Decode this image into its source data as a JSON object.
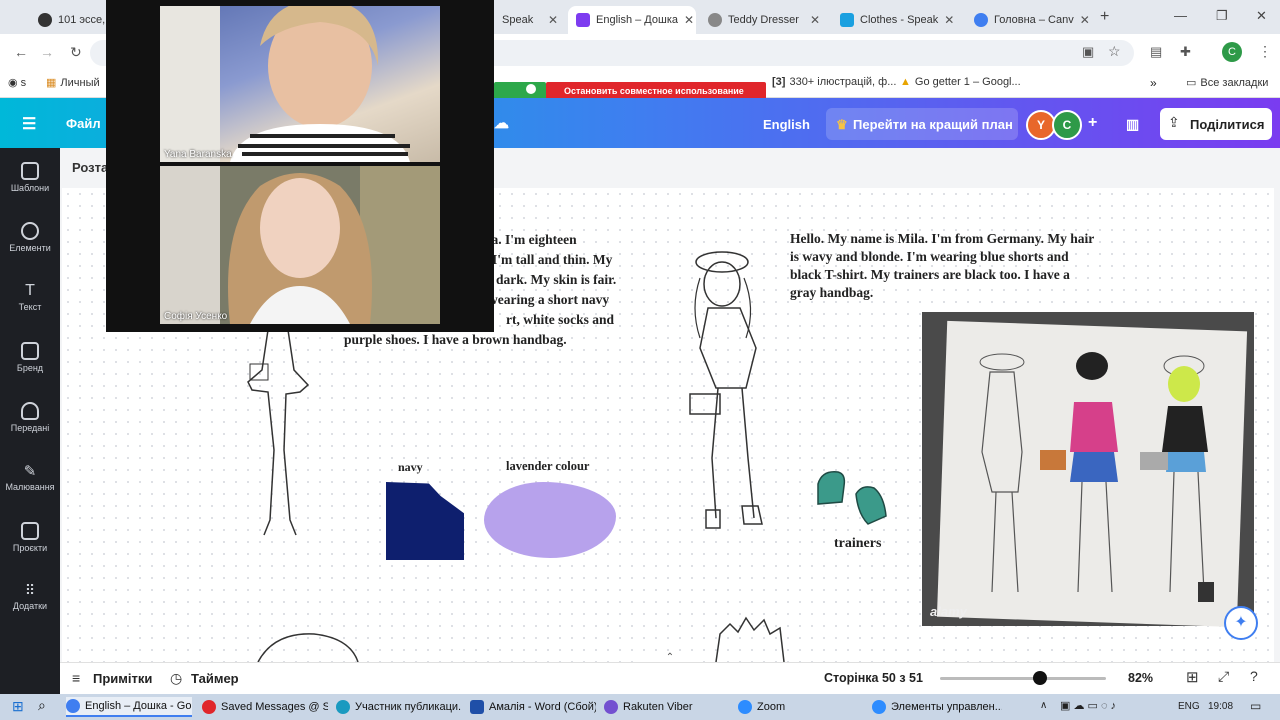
{
  "browser": {
    "tabs": [
      {
        "label": "101 эссе, к",
        "color": "#333"
      },
      {
        "label": "Speak",
        "color": "#e06010"
      },
      {
        "label": "English – Дошка",
        "color": "#7d3cf0"
      },
      {
        "label": "Teddy Dresser",
        "color": "#555"
      },
      {
        "label": "Clothes - Speak",
        "color": "#1aa0e0"
      },
      {
        "label": "Головна – Canv",
        "color": "#3f7ef0"
      }
    ],
    "bookmarks": [
      "Личный",
      "Остановить совместное использование",
      "330+ ілюстрацій, ф...",
      "Go getter 1 – Googl..."
    ],
    "all_bookmarks": "Все закладки",
    "profile_initial": "C"
  },
  "canva": {
    "file_menu": "Файл",
    "language": "English",
    "upgrade": "Перейти на кращий план",
    "avatars": [
      "Y",
      "C"
    ],
    "share": "Поділитися",
    "page_label": "Розта",
    "rail": [
      "Шаблони",
      "Елементи",
      "Текст",
      "Бренд",
      "Передані",
      "Малювання",
      "Проєкти",
      "Додатки"
    ]
  },
  "board": {
    "story1": [
      "da. I'm eighteen",
      "I'm tall and thin. My",
      "dark. My skin is fair.",
      "wearing  a short navy",
      "rt, white socks and",
      "purple shoes. I have a brown handbag."
    ],
    "story2": [
      "Hello. My name is Mila. I'm from Germany. My hair",
      "is wavy and blonde. I'm wearing blue shorts and",
      "black T-shirt. My trainers are black too. I have a",
      "gray handbag."
    ],
    "label_navy": "navy",
    "label_lavender": "lavender colour",
    "label_trainers": "trainers",
    "photo_watermark": "alamy",
    "colors": {
      "navy": "#0e1f6e",
      "lavender": "#b7a2ec"
    }
  },
  "video": {
    "participants": [
      "Yana Baranska",
      "Софія Усенко"
    ]
  },
  "bottom": {
    "notes": "Примітки",
    "timer": "Таймер",
    "page_indicator": "Сторінка 50 з 51",
    "zoom": "82%",
    "zoom_level": 0.82
  },
  "taskbar": {
    "items": [
      "English – Дошка - Go...",
      "Saved Messages @ So...",
      "Участник публикаци...",
      "Амалія - Word (Сбой)...",
      "Rakuten Viber",
      "Zoom",
      "Элементы управлен..."
    ],
    "lang": "ENG",
    "time": "19:08"
  }
}
